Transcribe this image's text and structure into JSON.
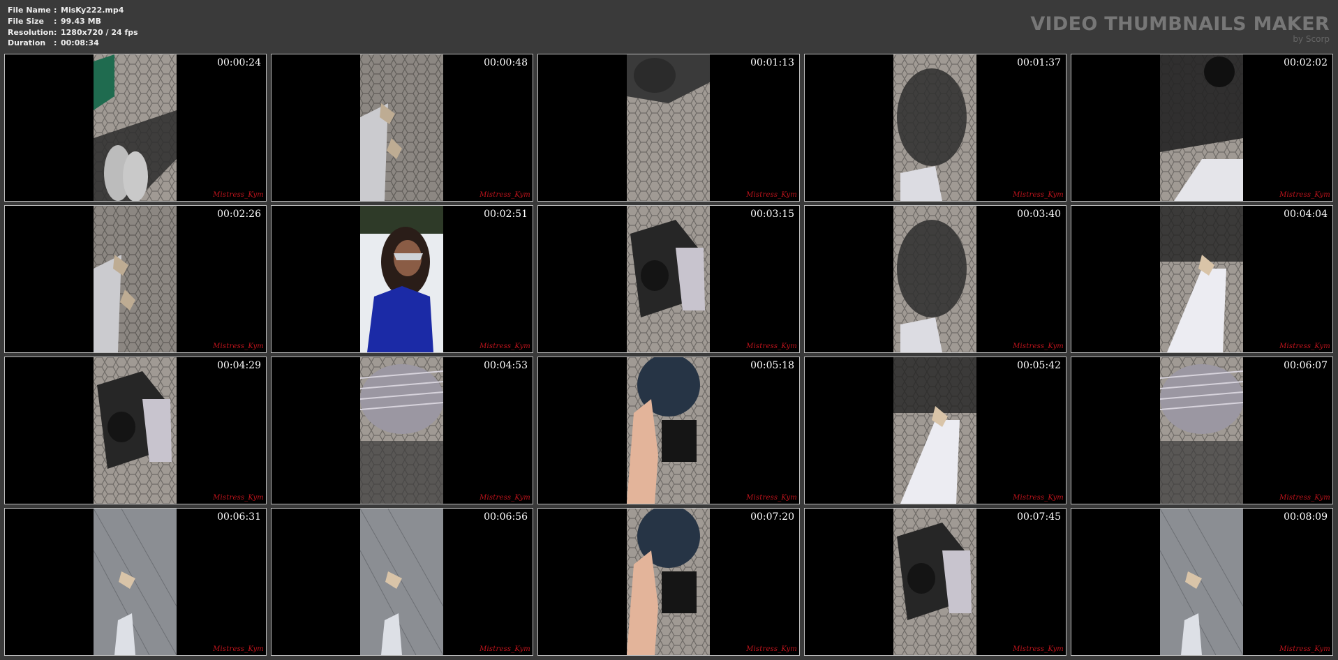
{
  "header": {
    "file_name_label": "File Name",
    "file_name": "MisKy222.mp4",
    "file_size_label": "File Size",
    "file_size": "99.43 MB",
    "resolution_label": "Resolution",
    "resolution": "1280x720 / 24 fps",
    "duration_label": "Duration",
    "duration": "00:08:34",
    "separator": ":",
    "brand_title": "VIDEO THUMBNAILS MAKER",
    "brand_sub": "by Scorp"
  },
  "watermark": "Mistress_Kym",
  "thumbnails": [
    {
      "time": "00:00:24",
      "scene": "paving-legs-green"
    },
    {
      "time": "00:00:48",
      "scene": "paving-feet"
    },
    {
      "time": "00:01:13",
      "scene": "paving-top"
    },
    {
      "time": "00:01:37",
      "scene": "shadow-paving"
    },
    {
      "time": "00:02:02",
      "scene": "chair-legs"
    },
    {
      "time": "00:02:26",
      "scene": "paving-feet"
    },
    {
      "time": "00:02:51",
      "scene": "masked-woman"
    },
    {
      "time": "00:03:15",
      "scene": "kneeling-man"
    },
    {
      "time": "00:03:40",
      "scene": "shadow-paving"
    },
    {
      "time": "00:04:04",
      "scene": "white-legs"
    },
    {
      "time": "00:04:29",
      "scene": "kneeling-man"
    },
    {
      "time": "00:04:53",
      "scene": "striped-shirt"
    },
    {
      "time": "00:05:18",
      "scene": "hand-hood"
    },
    {
      "time": "00:05:42",
      "scene": "white-legs"
    },
    {
      "time": "00:06:07",
      "scene": "striped-shirt"
    },
    {
      "time": "00:06:31",
      "scene": "tile-floor"
    },
    {
      "time": "00:06:56",
      "scene": "tile-floor"
    },
    {
      "time": "00:07:20",
      "scene": "hand-hood"
    },
    {
      "time": "00:07:45",
      "scene": "kneeling-man"
    },
    {
      "time": "00:08:09",
      "scene": "tile-floor"
    }
  ]
}
